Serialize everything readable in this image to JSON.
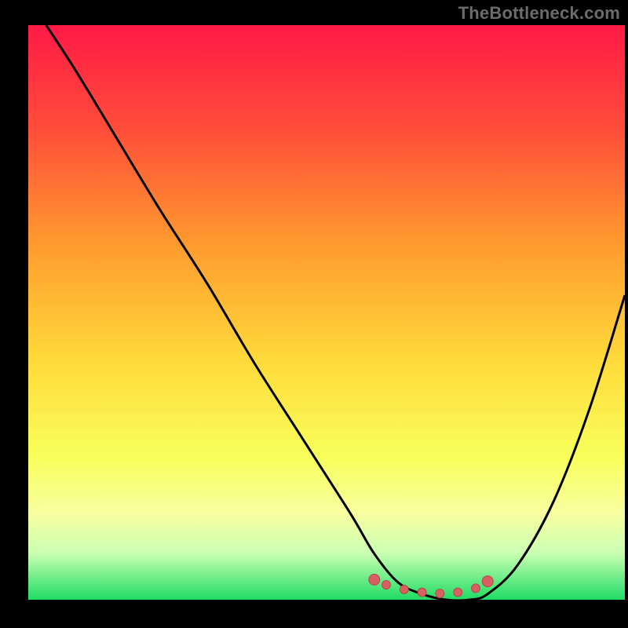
{
  "watermark": "TheBottleneck.com",
  "colors": {
    "frame": "#000000",
    "curve": "#000000",
    "marker_fill": "#d76060",
    "marker_stroke": "#b54a4a"
  },
  "chart_data": {
    "type": "line",
    "title": "",
    "xlabel": "",
    "ylabel": "",
    "xlim": [
      0,
      100
    ],
    "ylim": [
      0,
      100
    ],
    "grid": false,
    "series": [
      {
        "name": "bottleneck-curve",
        "x": [
          3,
          8,
          15,
          22,
          30,
          38,
          46,
          54,
          58,
          62,
          66,
          70,
          74,
          77,
          82,
          88,
          94,
          100
        ],
        "y": [
          100,
          92,
          80,
          68,
          55,
          41,
          28,
          15,
          8,
          3,
          1,
          0,
          0,
          1,
          6,
          17,
          33,
          53
        ]
      }
    ],
    "valley_markers": {
      "name": "optimal-range",
      "x": [
        58,
        60,
        63,
        66,
        69,
        72,
        75,
        77
      ],
      "y": [
        3.5,
        2.6,
        1.8,
        1.3,
        1.1,
        1.3,
        2.0,
        3.2
      ]
    },
    "gradient_stops": [
      {
        "offset": 0,
        "color": "#ff1a46"
      },
      {
        "offset": 18,
        "color": "#ff4d3a"
      },
      {
        "offset": 38,
        "color": "#ff9a2e"
      },
      {
        "offset": 58,
        "color": "#ffd93a"
      },
      {
        "offset": 75,
        "color": "#f8ff5a"
      },
      {
        "offset": 85,
        "color": "#f8ffa0"
      },
      {
        "offset": 92,
        "color": "#c9ffb3"
      },
      {
        "offset": 100,
        "color": "#1fdc64"
      }
    ]
  }
}
